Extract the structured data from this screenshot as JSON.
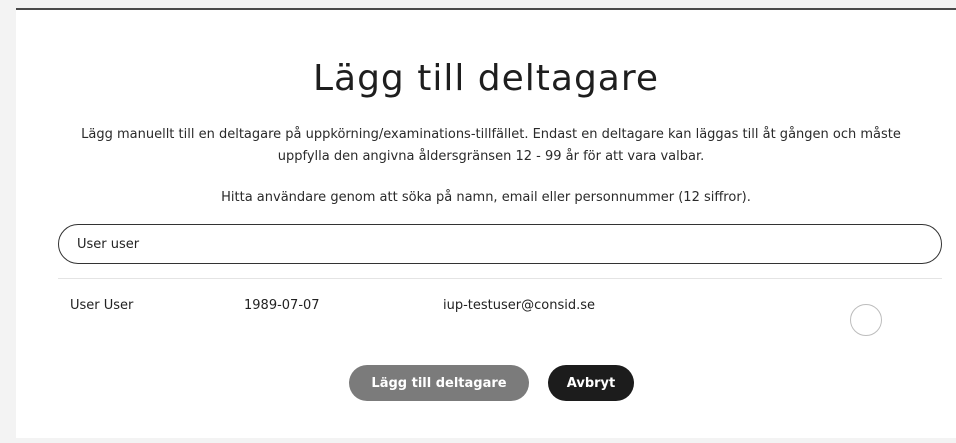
{
  "dialog": {
    "title": "Lägg till deltagare",
    "description": "Lägg manuellt till en deltagare på uppkörning/examinations-tillfället. Endast en deltagare kan läggas till åt gången och måste uppfylla den angivna åldersgränsen 12 - 99 år för att vara valbar.",
    "search_hint": "Hitta användare genom att söka på namn, email eller personnummer (12 siffror).",
    "search": {
      "value": "User user"
    },
    "results": [
      {
        "name": "User User",
        "birthdate": "1989-07-07",
        "email": "iup-testuser@consid.se",
        "selected": false
      }
    ],
    "buttons": {
      "add_label": "Lägg till deltagare",
      "cancel_label": "Avbryt"
    }
  },
  "colors": {
    "add_button": "#7b7b7b",
    "cancel_button": "#1c1c1c",
    "background": "#ffffff"
  }
}
